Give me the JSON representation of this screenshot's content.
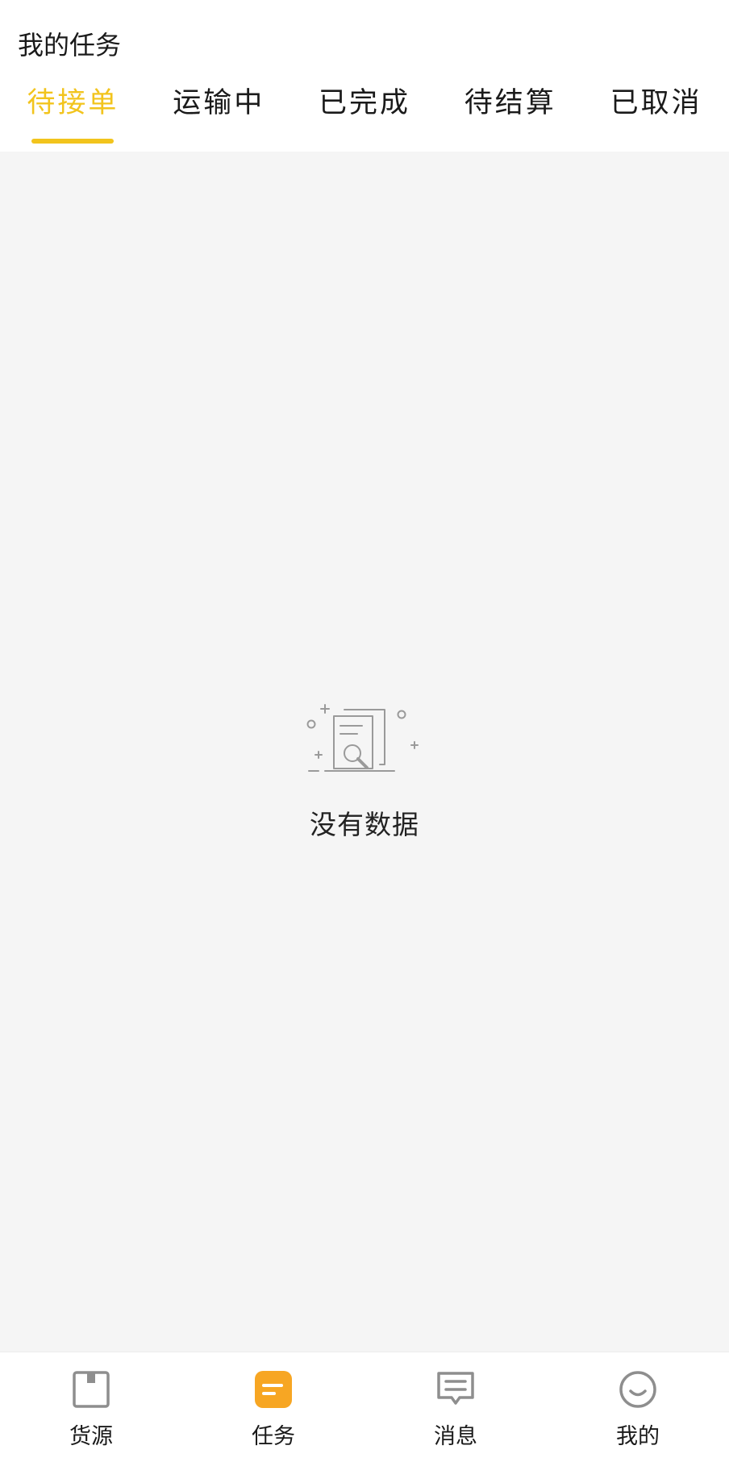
{
  "header": {
    "title": "我的任务"
  },
  "tabs": [
    {
      "label": "待接单",
      "active": true
    },
    {
      "label": "运输中",
      "active": false
    },
    {
      "label": "已完成",
      "active": false
    },
    {
      "label": "待结算",
      "active": false
    },
    {
      "label": "已取消",
      "active": false
    }
  ],
  "empty_state": {
    "icon": "empty-document-search-icon",
    "message": "没有数据"
  },
  "bottom_nav": [
    {
      "label": "货源",
      "icon": "box-icon",
      "active": false
    },
    {
      "label": "任务",
      "icon": "task-icon",
      "active": true
    },
    {
      "label": "消息",
      "icon": "message-icon",
      "active": false
    },
    {
      "label": "我的",
      "icon": "profile-smile-icon",
      "active": false
    }
  ],
  "colors": {
    "accent": "#f2c41d",
    "task_icon": "#f7a623",
    "inactive_icon": "#8e8e8e",
    "content_background": "#f5f5f5"
  }
}
